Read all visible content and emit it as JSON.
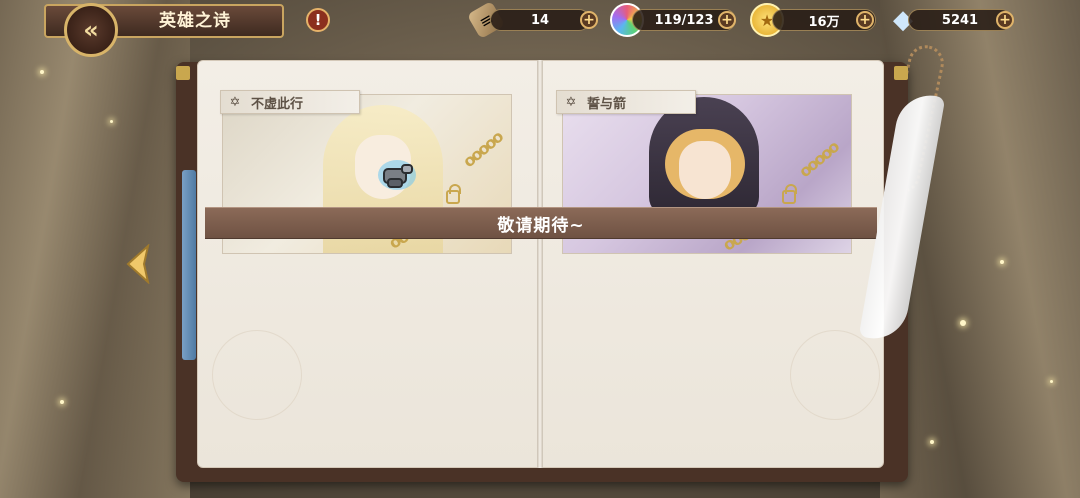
{
  "header": {
    "back_icon": "back-arrow-icon",
    "title": "英雄之诗",
    "info_label": "!"
  },
  "resources": [
    {
      "name": "ticket",
      "icon": "ticket-icon",
      "value": "14",
      "color": "#b49464"
    },
    {
      "name": "crystal",
      "icon": "rainbow-crystal-icon",
      "value": "119/123",
      "color": "#e85c7a"
    },
    {
      "name": "gold",
      "icon": "gold-coin-icon",
      "value": "16万",
      "color": "#f5c542"
    },
    {
      "name": "diamond",
      "icon": "diamond-icon",
      "value": "5241",
      "color": "#b6d8f5"
    }
  ],
  "resource_plus": "+",
  "book": {
    "left_card": {
      "title": "不虚此行",
      "star": "✡"
    },
    "right_card": {
      "title": "誓与箭",
      "star": "✡"
    },
    "banner_text": "敬请期待~"
  },
  "navigation": {
    "prev_icon": "left-arrow-icon"
  },
  "colors": {
    "accent_gold": "#c9a560",
    "ribbon": "#7b5d4c",
    "page": "#f0ebe2"
  }
}
